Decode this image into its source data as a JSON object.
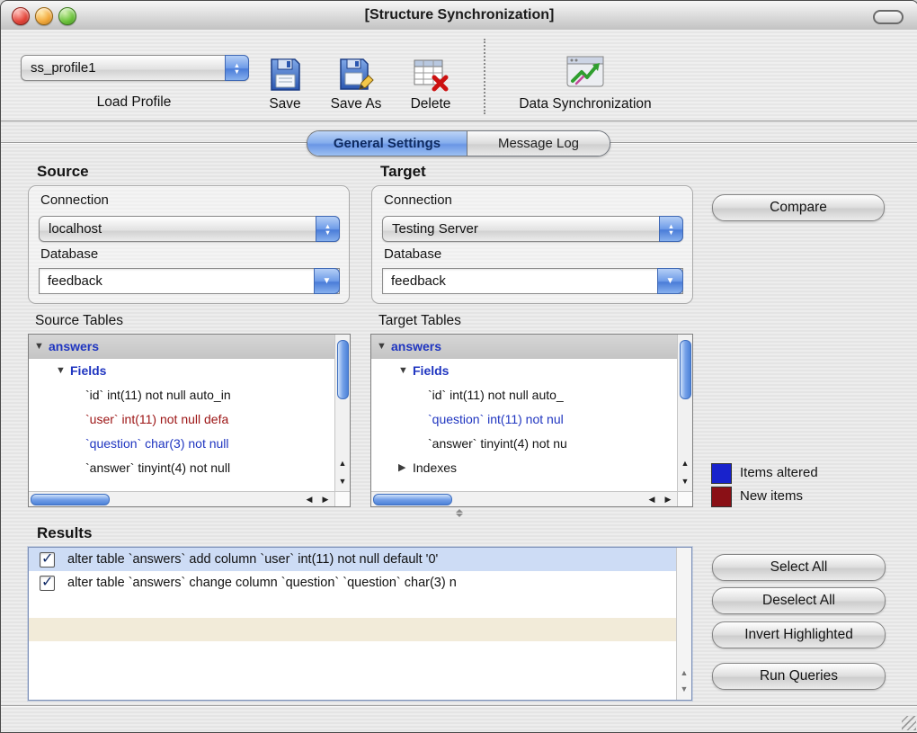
{
  "window": {
    "title": "[Structure Synchronization]"
  },
  "toolbar": {
    "profile_value": "ss_profile1",
    "load_profile_label": "Load Profile",
    "save_label": "Save",
    "save_as_label": "Save As",
    "delete_label": "Delete",
    "data_sync_label": "Data Synchronization"
  },
  "tabs": {
    "general_settings": "General Settings",
    "message_log": "Message Log"
  },
  "source": {
    "heading": "Source",
    "connection_label": "Connection",
    "connection_value": "localhost",
    "database_label": "Database",
    "database_value": "feedback",
    "tables_label": "Source Tables",
    "tree": [
      {
        "text": "answers",
        "color": "blue",
        "level": 0,
        "disclosure": "expanded"
      },
      {
        "text": "Fields",
        "color": "blue",
        "level": 1,
        "disclosure": "expanded"
      },
      {
        "text": "`id` int(11) not null auto_in",
        "color": "black",
        "level": 2
      },
      {
        "text": "`user` int(11) not null defa",
        "color": "red",
        "level": 2
      },
      {
        "text": "`question` char(3) not null",
        "color": "blue",
        "level": 2
      },
      {
        "text": "`answer` tinyint(4) not null",
        "color": "black",
        "level": 2
      }
    ]
  },
  "target": {
    "heading": "Target",
    "connection_label": "Connection",
    "connection_value": "Testing Server",
    "database_label": "Database",
    "database_value": "feedback",
    "tables_label": "Target Tables",
    "tree": [
      {
        "text": "answers",
        "color": "blue",
        "level": 0,
        "disclosure": "expanded"
      },
      {
        "text": "Fields",
        "color": "blue",
        "level": 1,
        "disclosure": "expanded"
      },
      {
        "text": "`id` int(11) not null auto_",
        "color": "black",
        "level": 2
      },
      {
        "text": "`question` int(11) not nul",
        "color": "blue",
        "level": 2
      },
      {
        "text": "`answer` tinyint(4) not nu",
        "color": "black",
        "level": 2
      },
      {
        "text": "Indexes",
        "color": "black",
        "level": 1,
        "disclosure": "collapsed"
      }
    ]
  },
  "compare_button_label": "Compare",
  "legend": [
    {
      "label": "Items altered",
      "color": "#1822cc"
    },
    {
      "label": "New items",
      "color": "#8a1016"
    }
  ],
  "results": {
    "heading": "Results",
    "rows": [
      {
        "checked": true,
        "highlighted": true,
        "text": "alter table `answers` add column `user` int(11) not null default '0'"
      },
      {
        "checked": true,
        "highlighted": false,
        "text": "alter table `answers` change column `question` `question` char(3) n"
      }
    ]
  },
  "action_buttons": {
    "select_all": "Select All",
    "deselect_all": "Deselect All",
    "invert_highlighted": "Invert Highlighted",
    "run_queries": "Run Queries"
  }
}
